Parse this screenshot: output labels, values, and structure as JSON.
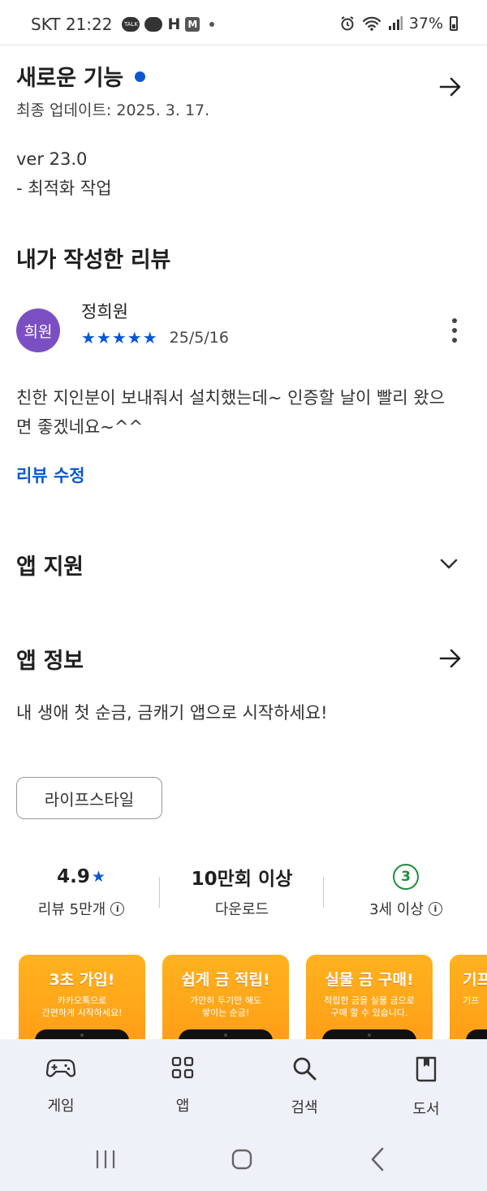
{
  "status_bar": {
    "carrier_time": "SKT 21:22",
    "talk_badge": "TALK",
    "h_badge": "H",
    "m_badge": "M",
    "battery": "37%"
  },
  "whats_new": {
    "title": "새로운 기능",
    "updated": "최종 업데이트: 2025. 3. 17.",
    "version": "ver 23.0",
    "note": "- 최적화 작업"
  },
  "my_review": {
    "title": "내가 작성한 리뷰",
    "avatar_text": "희원",
    "author": "정희원",
    "stars": "★★★★★",
    "rating": 5,
    "date": "25/5/16",
    "text": "친한 지인분이 보내줘서 설치했는데~ 인증할 날이 빨리 왔으면 좋겠네요~^^",
    "edit_label": "리뷰 수정"
  },
  "app_support": {
    "title": "앱 지원"
  },
  "app_info": {
    "title": "앱 정보",
    "description": "내 생애 첫 순금, 금캐기 앱으로 시작하세요!",
    "category_chip": "라이프스타일"
  },
  "stats": {
    "rating_value": "4.9",
    "rating_star": "★",
    "rating_label": "리뷰 5만개",
    "downloads_value": "10만회 이상",
    "downloads_label": "다운로드",
    "age_badge": "3",
    "age_label": "3세 이상"
  },
  "screenshots": [
    {
      "title": "3초 가입!",
      "desc": "카카오톡으로\n간편하게 시작하세요!"
    },
    {
      "title": "쉽게 금 적립!",
      "desc": "가만히 두기만 해도\n쌓이는 순금!"
    },
    {
      "title": "실물 금 구매!",
      "desc": "적립한 금을 실물 금으로\n구매 할 수 있습니다."
    },
    {
      "title": "기프",
      "desc": "기프"
    }
  ],
  "bottom_nav": [
    {
      "label": "게임",
      "icon": "gamepad-icon"
    },
    {
      "label": "앱",
      "icon": "apps-grid-icon"
    },
    {
      "label": "검색",
      "icon": "search-icon"
    },
    {
      "label": "도서",
      "icon": "book-icon"
    }
  ],
  "colors": {
    "accent_blue": "#0b57d0",
    "avatar_purple": "#7b4fc4",
    "age_green": "#1e8e3e",
    "screenshot_orange": "#ff9a16",
    "nav_bg": "#eef1f7"
  }
}
